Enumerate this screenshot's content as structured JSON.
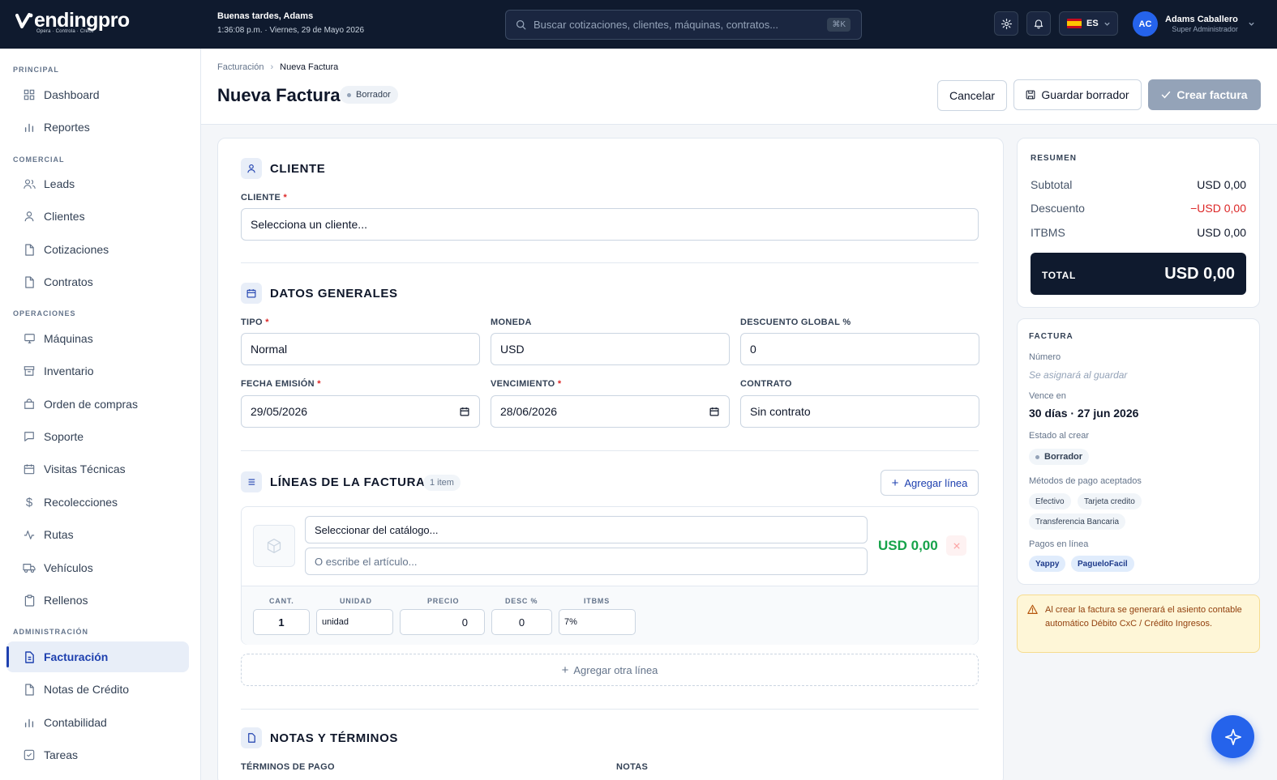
{
  "brand": {
    "name": "endingpro",
    "tagline": "Opera · Controla · Crece"
  },
  "header": {
    "greeting": "Buenas tardes, Adams",
    "datetime": "1:36:08 p.m. · Viernes, 29 de Mayo 2026",
    "search_placeholder": "Buscar cotizaciones, clientes, máquinas, contratos...",
    "search_shortcut": "⌘K",
    "language": "ES",
    "user_initials": "AC",
    "user_name": "Adams Caballero",
    "user_role": "Super Administrador"
  },
  "sidebar": {
    "sections": {
      "principal": "PRINCIPAL",
      "comercial": "COMERCIAL",
      "operaciones": "OPERACIONES",
      "administracion": "ADMINISTRACIÓN"
    },
    "items": {
      "dashboard": "Dashboard",
      "reportes": "Reportes",
      "leads": "Leads",
      "clientes": "Clientes",
      "cotizaciones": "Cotizaciones",
      "contratos": "Contratos",
      "maquinas": "Máquinas",
      "inventario": "Inventario",
      "orden": "Orden de compras",
      "soporte": "Soporte",
      "visitas": "Visitas Técnicas",
      "recolecciones": "Recolecciones",
      "rutas": "Rutas",
      "vehiculos": "Vehículos",
      "rellenos": "Rellenos",
      "facturacion": "Facturación",
      "notas": "Notas de Crédito",
      "contabilidad": "Contabilidad",
      "tareas": "Tareas"
    }
  },
  "page": {
    "breadcrumb_parent": "Facturación",
    "breadcrumb_current": "Nueva Factura",
    "title": "Nueva Factura",
    "status": "Borrador",
    "cancel": "Cancelar",
    "save_draft": "Guardar borrador",
    "create": "Crear factura"
  },
  "form": {
    "cliente_section": "CLIENTE",
    "cliente_label": "CLIENTE",
    "cliente_value": "Selecciona un cliente...",
    "datos_section": "DATOS GENERALES",
    "tipo_label": "TIPO",
    "tipo_value": "Normal",
    "moneda_label": "MONEDA",
    "moneda_value": "USD",
    "descuento_label": "DESCUENTO GLOBAL %",
    "descuento_value": "0",
    "fecha_label": "FECHA EMISIÓN",
    "fecha_value": "29/05/2026",
    "venc_label": "VENCIMIENTO",
    "venc_value": "28/06/2026",
    "contrato_label": "CONTRATO",
    "contrato_value": "Sin contrato",
    "lineas_section": "LÍNEAS DE LA FACTURA",
    "lineas_count": "1 item",
    "add_line": "Agregar línea",
    "line": {
      "catalog_placeholder": "Seleccionar del catálogo...",
      "article_placeholder": "O escribe el artículo...",
      "amount": "USD 0,00",
      "cant_label": "CANT.",
      "cant_value": "1",
      "unidad_label": "UNIDAD",
      "unidad_value": "unidad",
      "precio_label": "PRECIO",
      "precio_value": "0",
      "desc_label": "DESC %",
      "desc_value": "0",
      "itbms_label": "ITBMS",
      "itbms_value": "7%"
    },
    "add_other_line": "Agregar otra línea",
    "notas_section": "NOTAS Y TÉRMINOS",
    "terminos_label": "TÉRMINOS DE PAGO",
    "notas_label": "NOTAS"
  },
  "resumen": {
    "title": "RESUMEN",
    "subtotal_label": "Subtotal",
    "subtotal_value": "USD 0,00",
    "descuento_label": "Descuento",
    "descuento_value": "−USD 0,00",
    "itbms_label": "ITBMS",
    "itbms_value": "USD 0,00",
    "total_label": "TOTAL",
    "total_value": "USD 0,00"
  },
  "factura": {
    "title": "FACTURA",
    "numero_label": "Número",
    "numero_value": "Se asignará al guardar",
    "vence_label": "Vence en",
    "vence_value": "30 días · 27 jun 2026",
    "estado_label": "Estado al crear",
    "estado_value": "Borrador",
    "metodos_label": "Métodos de pago aceptados",
    "metodos": [
      "Efectivo",
      "Tarjeta credito",
      "Transferencia Bancaria"
    ],
    "pagos_label": "Pagos en línea",
    "pagos": [
      "Yappy",
      "PagueloFacil"
    ]
  },
  "alert": "Al crear la factura se generará el asiento contable automático Débito CxC / Crédito Ingresos.",
  "colors": {
    "navy": "#0f1a2e",
    "accent": "#2563eb",
    "danger": "#dc2626",
    "success": "#16a34a"
  }
}
